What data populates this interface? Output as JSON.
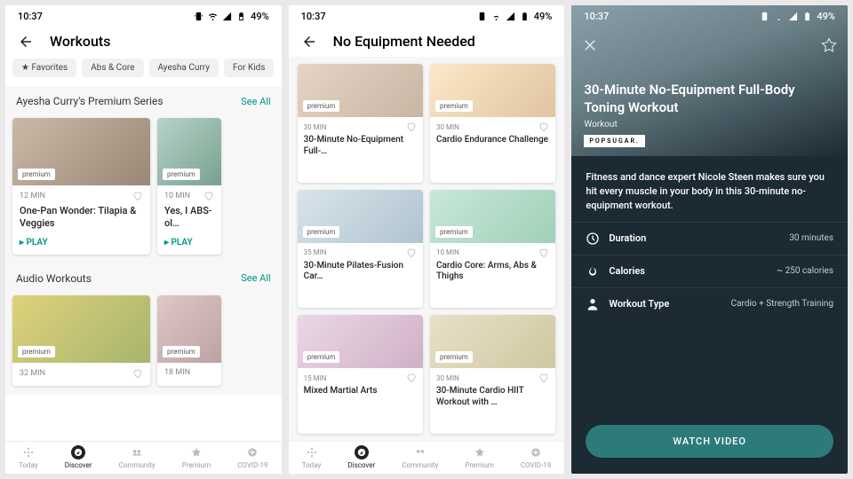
{
  "status": {
    "time": "10:37",
    "battery": "49%"
  },
  "phone1": {
    "title": "Workouts",
    "chips": [
      "★ Favorites",
      "Abs & Core",
      "Ayesha Curry",
      "For Kids"
    ],
    "sections": [
      {
        "title": "Ayesha Curry's Premium Series",
        "seeall": "See All",
        "cards": [
          {
            "dur": "12 MIN",
            "title": "One-Pan Wonder: Tilapia & Veggies",
            "play": "▸  PLAY",
            "premium": "premium"
          },
          {
            "dur": "10 MIN",
            "title": "Yes, I ABS-ol…",
            "play": "▸  PLAY",
            "premium": "premium"
          }
        ]
      },
      {
        "title": "Audio Workouts",
        "seeall": "See All",
        "cards": [
          {
            "dur": "32 MIN",
            "title": "",
            "premium": "premium"
          },
          {
            "dur": "18 MIN",
            "title": "",
            "premium": "premium"
          }
        ]
      }
    ]
  },
  "phone2": {
    "title": "No Equipment Needed",
    "cards": [
      {
        "dur": "30 MIN",
        "title": "30-Minute No-Equipment Full-…",
        "premium": "premium"
      },
      {
        "dur": "30 MIN",
        "title": "Cardio Endurance Challenge",
        "premium": "premium"
      },
      {
        "dur": "35 MIN",
        "title": "30-Minute Pilates-Fusion Car…",
        "premium": "premium"
      },
      {
        "dur": "10 MIN",
        "title": "Cardio Core: Arms, Abs & Thighs",
        "premium": "premium"
      },
      {
        "dur": "15 MIN",
        "title": "Mixed Martial Arts",
        "premium": "premium"
      },
      {
        "dur": "30 MIN",
        "title": "30-Minute Cardio HIIT Workout with …",
        "premium": "premium"
      }
    ]
  },
  "phone3": {
    "title": "30-Minute No-Equipment Full-Body Toning Workout",
    "sub": "Workout",
    "brand": "POPSUGAR.",
    "desc": "Fitness and dance expert Nicole Steen makes sure you hit every muscle in your body in this 30-minute no-equipment workout.",
    "stats": [
      {
        "label": "Duration",
        "val": "30 minutes"
      },
      {
        "label": "Calories",
        "val": "~ 250 calories"
      },
      {
        "label": "Workout Type",
        "val": "Cardio + Strength Training"
      }
    ],
    "watch": "WATCH VIDEO"
  },
  "nav": [
    "Today",
    "Discover",
    "Community",
    "Premium",
    "COVID-19"
  ]
}
